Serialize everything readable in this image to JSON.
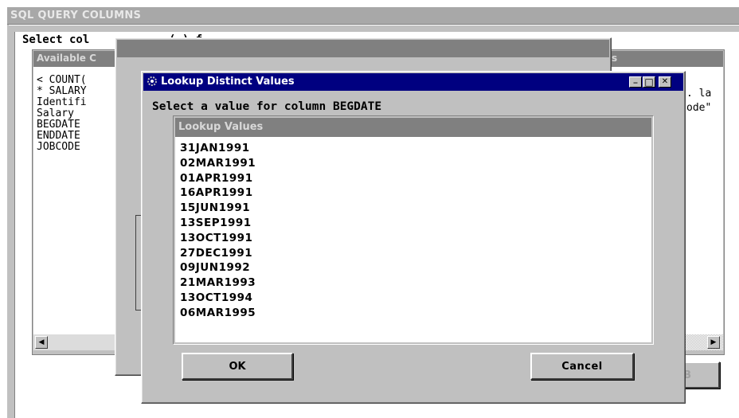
{
  "back_window": {
    "title": "SQL QUERY COLUMNS",
    "instruction": "Select col",
    "instruction_partial": "( ) f",
    "available_header": "Available C",
    "available_items": [
      "< COUNT(",
      "* SALARY",
      "Identifi",
      "Salary",
      "BEGDATE",
      "ENDDATE",
      "JOBCODE"
    ],
    "right_header_fragment": "s",
    "right_items": [
      ". la",
      "ode\""
    ],
    "hidden_button_fragment": "B"
  },
  "dialog": {
    "title": "Lookup Distinct Values",
    "prompt": "Select a value for column BEGDATE",
    "list_header": "Lookup Values",
    "values": [
      "31JAN1991",
      "02MAR1991",
      "01APR1991",
      "16APR1991",
      "15JUN1991",
      "13SEP1991",
      "13OCT1991",
      "27DEC1991",
      "09JUN1992",
      "21MAR1993",
      "13OCT1994",
      "06MAR1995"
    ],
    "ok_label": "OK",
    "cancel_label": "Cancel",
    "minimize_glyph": "_",
    "maximize_glyph": "□",
    "close_glyph": "✕"
  },
  "colors": {
    "titlebar_active": "#000080",
    "window_face": "#c0c0c0",
    "header_gray": "#808080"
  }
}
